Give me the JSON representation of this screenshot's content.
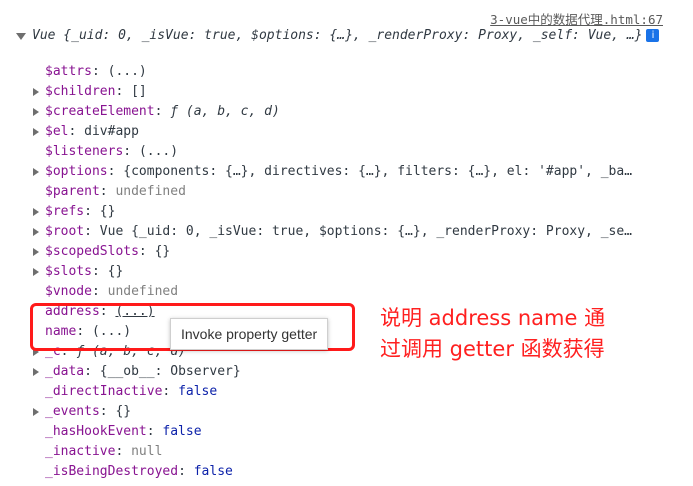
{
  "source_link": "3-vue中的数据代理.html:67",
  "header": {
    "text": "Vue {_uid: 0, _isVue: true, $options: {…}, _renderProxy: Proxy, _self: Vue, …}",
    "info_icon": "i"
  },
  "rows": [
    {
      "key": "$attrs",
      "value": "(...)",
      "arrow": false
    },
    {
      "key": "$children",
      "value": "[]",
      "arrow": true
    },
    {
      "key": "$createElement",
      "value": "ƒ (a, b, c, d)",
      "arrow": true
    },
    {
      "key": "$el",
      "value": "div#app",
      "arrow": true
    },
    {
      "key": "$listeners",
      "value": "(...)",
      "arrow": false
    },
    {
      "key": "$options",
      "value": "{components: {…}, directives: {…}, filters: {…}, el: '#app', _ba…",
      "arrow": true
    },
    {
      "key": "$parent",
      "value": "undefined",
      "arrow": false
    },
    {
      "key": "$refs",
      "value": "{}",
      "arrow": true
    },
    {
      "key": "$root",
      "value": "Vue {_uid: 0, _isVue: true, $options: {…}, _renderProxy: Proxy, _se…",
      "arrow": true
    },
    {
      "key": "$scopedSlots",
      "value": "{}",
      "arrow": true
    },
    {
      "key": "$slots",
      "value": "{}",
      "arrow": true
    },
    {
      "key": "$vnode",
      "value": "undefined",
      "arrow": false
    },
    {
      "key": "address",
      "value": "(...)",
      "arrow": false
    },
    {
      "key": "name",
      "value": "(...)",
      "arrow": false
    },
    {
      "key": "_c",
      "value": "ƒ (a, b, c, d)",
      "arrow": true
    },
    {
      "key": "_data",
      "value": "{__ob__: Observer}",
      "arrow": true
    },
    {
      "key": "_directInactive",
      "value": "false",
      "arrow": false
    },
    {
      "key": "_events",
      "value": "{}",
      "arrow": true
    },
    {
      "key": "_hasHookEvent",
      "value": "false",
      "arrow": false
    },
    {
      "key": "_inactive",
      "value": "null",
      "arrow": false
    },
    {
      "key": "_isBeingDestroyed",
      "value": "false",
      "arrow": false
    }
  ],
  "tooltip": "Invoke property getter",
  "annotation": {
    "line1": "说明 address name 通",
    "line2": "过调用 getter 函数获得"
  },
  "colors": {
    "key": "#881391",
    "keyword": "#0d22aa",
    "number": "#1c00cf",
    "string": "#c41a16",
    "highlight": "#ff1a1a",
    "info_badge": "#1a73e8"
  }
}
